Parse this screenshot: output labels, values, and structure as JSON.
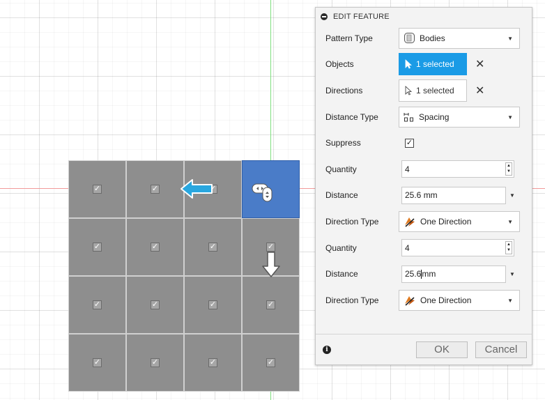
{
  "colors": {
    "accent": "#1a9be6",
    "seed_body": "#4a7cc8",
    "pattern_body": "#8e8e8e",
    "axis_green": "#7fe07f",
    "axis_red": "#f29a9a",
    "arrow_blue": "#29a7df"
  },
  "panel": {
    "title": "EDIT FEATURE",
    "header_icon": "collapse-dot-icon",
    "rows": {
      "pattern_type": {
        "label": "Pattern Type",
        "value": "Bodies",
        "icon": "body-icon"
      },
      "objects": {
        "label": "Objects",
        "value": "1 selected",
        "icon": "cursor-icon"
      },
      "directions": {
        "label": "Directions",
        "value": "1 selected",
        "icon": "cursor-icon"
      },
      "distance_type": {
        "label": "Distance Type",
        "value": "Spacing",
        "icon": "spacing-icon"
      },
      "suppress": {
        "label": "Suppress",
        "checked": true
      },
      "quantity1": {
        "label": "Quantity",
        "value": "4"
      },
      "distance1": {
        "label": "Distance",
        "value": "25.6 mm"
      },
      "direction_type1": {
        "label": "Direction Type",
        "value": "One Direction",
        "icon": "one-direction-icon"
      },
      "quantity2": {
        "label": "Quantity",
        "value": "4"
      },
      "distance2": {
        "label": "Distance",
        "value_left": "25.6",
        "value_right": "mm"
      },
      "direction_type2": {
        "label": "Direction Type",
        "value": "One Direction",
        "icon": "one-direction-icon"
      }
    },
    "clear_symbol": "✕",
    "ok_label": "OK",
    "cancel_label": "Cancel",
    "info_symbol": "i"
  },
  "canvas": {
    "grid_rows": 4,
    "grid_cols": 4,
    "seed_index": 3,
    "check_symbol": "✓"
  }
}
